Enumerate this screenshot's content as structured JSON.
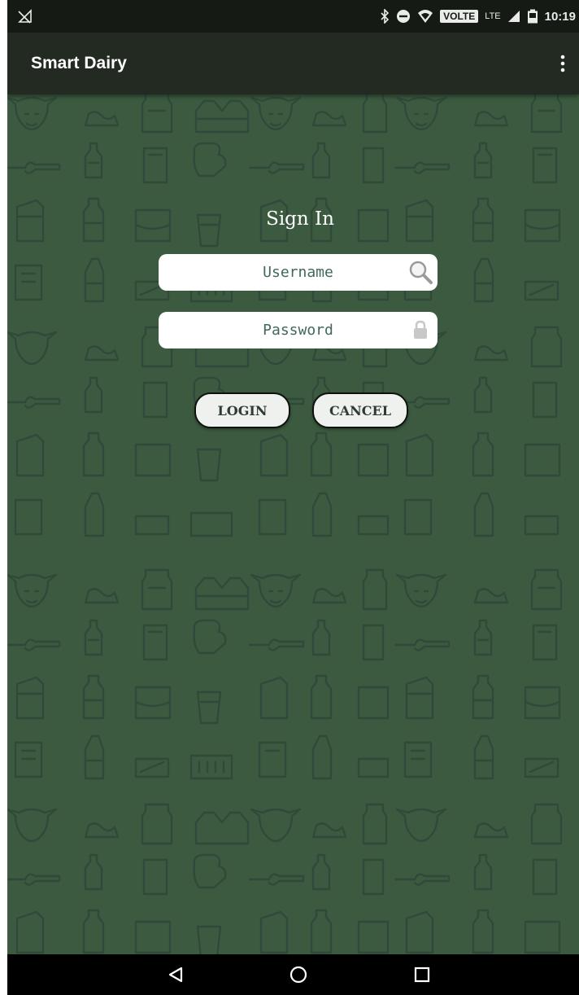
{
  "status_bar": {
    "volte": "VOLTE",
    "network": "LTE",
    "time": "10:19",
    "icons": [
      "signal-off-icon",
      "bluetooth-icon",
      "do-not-disturb-icon",
      "wifi-icon",
      "cell-signal-icon",
      "battery-icon"
    ]
  },
  "app_bar": {
    "title": "Smart Dairy",
    "menu_icon": "more-vert-icon"
  },
  "sign_in": {
    "title": "Sign In",
    "username_placeholder": "Username",
    "password_placeholder": "Password",
    "username_icon": "search-icon",
    "password_icon": "lock-icon",
    "login_label": "LOGIN",
    "cancel_label": "CANCEL"
  },
  "nav_bar": {
    "icons": [
      "back-icon",
      "home-icon",
      "recents-icon"
    ]
  },
  "colors": {
    "background": "#3b5a3f",
    "pattern": "#33503a",
    "app_bar": "#232a22",
    "status_bar": "#151a15",
    "button_bg": "#eef1ee",
    "placeholder_text": "#41685a"
  }
}
